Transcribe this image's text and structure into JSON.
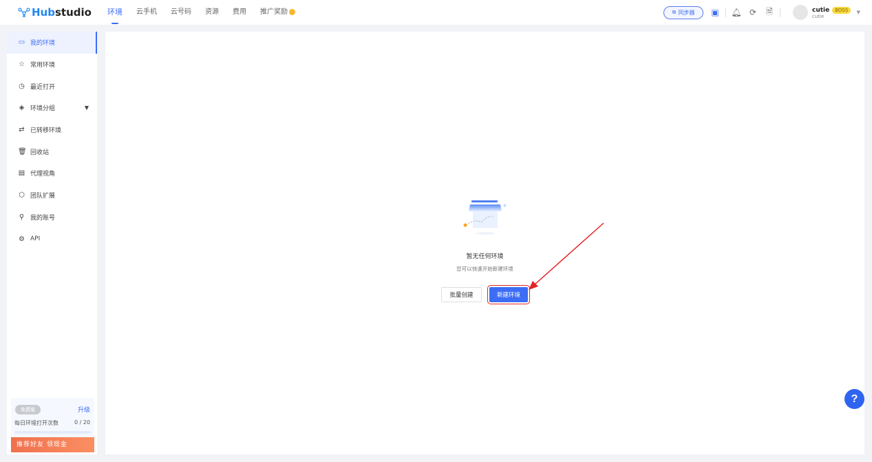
{
  "header": {
    "logo_prefix": "Hub",
    "logo_suffix": "studio",
    "nav": [
      "环境",
      "云手机",
      "云号码",
      "资源",
      "费用",
      "推广奖励"
    ],
    "sync_label": "同步器",
    "user_name": "cutie",
    "user_badge": "BOSS",
    "user_sub": "cutie"
  },
  "sidebar": {
    "items": [
      {
        "label": "我的环境",
        "icon": "▭"
      },
      {
        "label": "常用环境",
        "icon": "☆"
      },
      {
        "label": "最近打开",
        "icon": "◷"
      },
      {
        "label": "环境分组",
        "icon": "◈"
      },
      {
        "label": "已转移环境",
        "icon": "⇄"
      },
      {
        "label": "回收站",
        "icon": "🗑"
      },
      {
        "label": "代理视角",
        "icon": "▤"
      },
      {
        "label": "团队扩展",
        "icon": "⬡"
      },
      {
        "label": "我的账号",
        "icon": "⚲"
      },
      {
        "label": "API",
        "icon": "⚙"
      }
    ],
    "plan": {
      "badge": "免费版",
      "upgrade": "升级",
      "count_label": "每日环境打开次数",
      "count_value": "0 / 20",
      "usage_fraction": 0,
      "promo": "推荐好友 领现金"
    }
  },
  "main": {
    "empty_title": "暂无任何环境",
    "empty_sub": "您可以快速开始新建环境",
    "batch_create": "批量创建",
    "new_env": "新建环境"
  },
  "help": "?",
  "colors": {
    "accent": "#3d6df5",
    "highlight": "#e52222"
  }
}
